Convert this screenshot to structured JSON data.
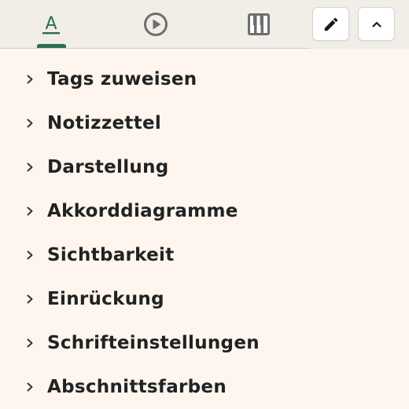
{
  "toolbar": {
    "tabs": [
      {
        "icon": "text-format-icon",
        "active": true
      },
      {
        "icon": "play-circle-icon",
        "active": false
      },
      {
        "icon": "piano-icon",
        "active": false
      }
    ],
    "buttons": [
      {
        "icon": "pencil-icon"
      },
      {
        "icon": "chevron-up-icon"
      }
    ],
    "accent_color": "#2e6d4d"
  },
  "menu": {
    "items": [
      {
        "label": "Tags zuweisen"
      },
      {
        "label": "Notizzettel"
      },
      {
        "label": "Darstellung"
      },
      {
        "label": "Akkorddiagramme"
      },
      {
        "label": "Sichtbarkeit"
      },
      {
        "label": "Einrückung"
      },
      {
        "label": "Schrifteinstellungen"
      },
      {
        "label": "Abschnittsfarben"
      }
    ]
  },
  "colors": {
    "page_background": "#fdf5ee",
    "toolbar_background": "#f1eee8",
    "text": "#222222"
  }
}
